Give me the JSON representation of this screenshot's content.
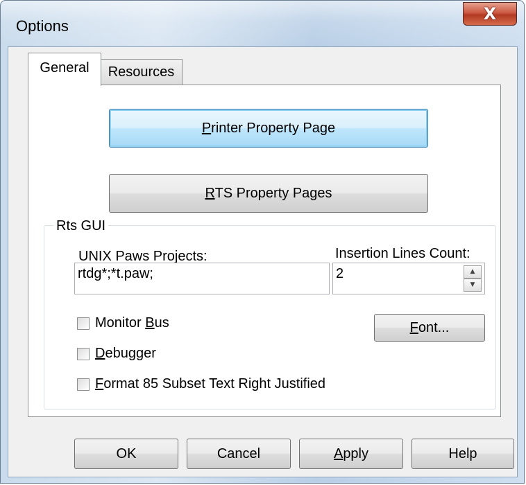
{
  "window": {
    "title": "Options",
    "close_glyph": "X"
  },
  "tabs": [
    {
      "label": "General",
      "active": true
    },
    {
      "label": "Resources",
      "active": false
    }
  ],
  "general": {
    "printer_button": {
      "mnemonic": "P",
      "rest": "rinter Property Page"
    },
    "rts_button": {
      "mnemonic": "R",
      "rest": "TS Property Pages"
    },
    "group_title": "Rts GUI",
    "unix_label": "UNIX Paws Projects:",
    "unix_value": "rtdg*;*t.paw;",
    "insertion_label": "Insertion Lines Count:",
    "insertion_value": "2",
    "font_button": {
      "mnemonic": "F",
      "rest": "ont..."
    },
    "checkboxes": [
      {
        "pre": "Monitor ",
        "mnemonic": "B",
        "rest": "us",
        "checked": false
      },
      {
        "pre": "",
        "mnemonic": "D",
        "rest": "ebugger",
        "checked": false
      },
      {
        "pre": "",
        "mnemonic": "F",
        "rest": "ormat 85 Subset Text Right Justified",
        "checked": false
      }
    ]
  },
  "footer": {
    "ok": "OK",
    "cancel": "Cancel",
    "apply": {
      "mnemonic": "A",
      "rest": "pply"
    },
    "help": "Help"
  },
  "icons": {
    "spin_up": "up-arrow-icon",
    "spin_down": "down-arrow-icon"
  }
}
